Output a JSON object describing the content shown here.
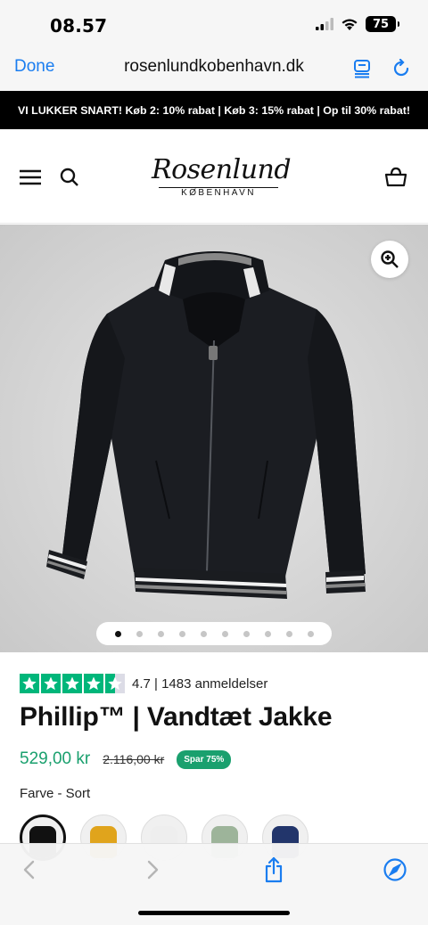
{
  "status": {
    "time": "08.57",
    "battery": "75"
  },
  "browser": {
    "done_label": "Done",
    "url": "rosenlundkobenhavn.dk"
  },
  "promo": {
    "text": "VI LUKKER SNART! Køb 2: 10% rabat | Køb 3: 15% rabat | Op til 30% rabat!"
  },
  "header": {
    "logo_script": "Rosenlund",
    "logo_sub": "KØBENHAVN"
  },
  "gallery": {
    "dot_count": 10,
    "active_index": 0
  },
  "product": {
    "rating_value": "4.7",
    "rating_text": "4.7 | 1483 anmeldelser",
    "stars_filled": 4.5,
    "title": "Phillip™ | Vandtæt Jakke",
    "price": "529,00 kr",
    "old_price": "2.116,00 kr",
    "save_badge": "Spar 75%",
    "color_label": "Farve - Sort",
    "swatches": [
      {
        "name": "Sort",
        "color": "#111111",
        "selected": true
      },
      {
        "name": "Gul",
        "color": "#e0a41c",
        "selected": false
      },
      {
        "name": "Hvid",
        "color": "#eeeeee",
        "selected": false
      },
      {
        "name": "Grøn",
        "color": "#9db49a",
        "selected": false
      },
      {
        "name": "Blå",
        "color": "#22356b",
        "selected": false
      }
    ]
  },
  "colors": {
    "accent_link": "#1a7df0",
    "price_green": "#1aa06e",
    "trustpilot": "#00b67a"
  },
  "icons": [
    "menu-icon",
    "search-icon",
    "basket-icon",
    "zoom-icon",
    "back-icon",
    "forward-icon",
    "share-icon",
    "compass-icon",
    "reader-icon",
    "reload-icon"
  ]
}
